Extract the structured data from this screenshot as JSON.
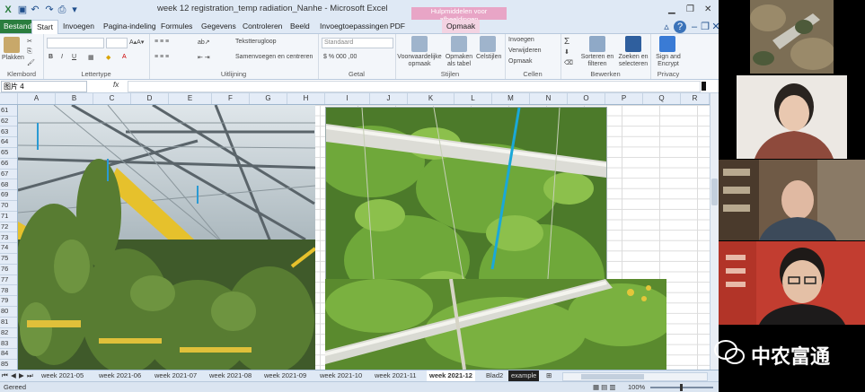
{
  "window": {
    "title": "week 12 registration_temp radiation_Nanhe  -  Microsoft Excel",
    "context_group": "Hulpmiddelen voor afbeeldingen"
  },
  "tabs": [
    "Bestand",
    "Start",
    "Invoegen",
    "Pagina-indeling",
    "Formules",
    "Gegevens",
    "Controleren",
    "Beeld",
    "Invoegtoepassingen",
    "PDF",
    "Opmaak"
  ],
  "ribbon": {
    "klembord": {
      "label": "Klembord",
      "plakken": "Plakken"
    },
    "lettertype": {
      "label": "Lettertype"
    },
    "uitlijning": {
      "label": "Uitlijning",
      "tekstterugloop": "Tekstterugloop",
      "samenvoegen": "Samenvoegen en centreren"
    },
    "getal": {
      "label": "Getal",
      "format": "Standaard"
    },
    "stijlen": {
      "label": "Stijlen",
      "voorwaardelijk": "Voorwaardelijke opmaak",
      "als_tabel": "Opmaken als tabel",
      "celstijlen": "Celstijlen"
    },
    "cellen": {
      "label": "Cellen",
      "invoegen": "Invoegen",
      "verwijderen": "Verwijderen",
      "opmaak": "Opmaak"
    },
    "bewerken": {
      "label": "Bewerken",
      "sorteren": "Sorteren en filteren",
      "zoeken": "Zoeken en selecteren"
    },
    "privacy": {
      "label": "Privacy",
      "sign": "Sign and Encrypt"
    }
  },
  "formula_bar": {
    "name_box": "图片 4",
    "fx": "fx",
    "value": ""
  },
  "columns": [
    "A",
    "B",
    "C",
    "D",
    "E",
    "F",
    "G",
    "H",
    "I",
    "J",
    "K",
    "L",
    "M",
    "N",
    "O",
    "P",
    "Q",
    "R"
  ],
  "rows": [
    "61",
    "62",
    "63",
    "64",
    "65",
    "66",
    "67",
    "68",
    "69",
    "70",
    "71",
    "72",
    "73",
    "74",
    "75",
    "76",
    "77",
    "78",
    "79",
    "80",
    "81",
    "82",
    "83",
    "84",
    "85"
  ],
  "sheets": [
    "week 2021-05",
    "week 2021-06",
    "week 2021-07",
    "week 2021-08",
    "week 2021-09",
    "week 2021-10",
    "week 2021-11",
    "week 2021-12",
    "Blad2",
    "example"
  ],
  "active_sheet": "week 2021-12",
  "status": {
    "left": "Gereed",
    "zoom": "100%"
  },
  "watermark": "中农富通",
  "colors": {
    "excel_green": "#2a7d3e",
    "ribbon_bg": "#f3f6fa",
    "context_pink": "#e8a5c6",
    "active_sheet": "#ffffff"
  }
}
